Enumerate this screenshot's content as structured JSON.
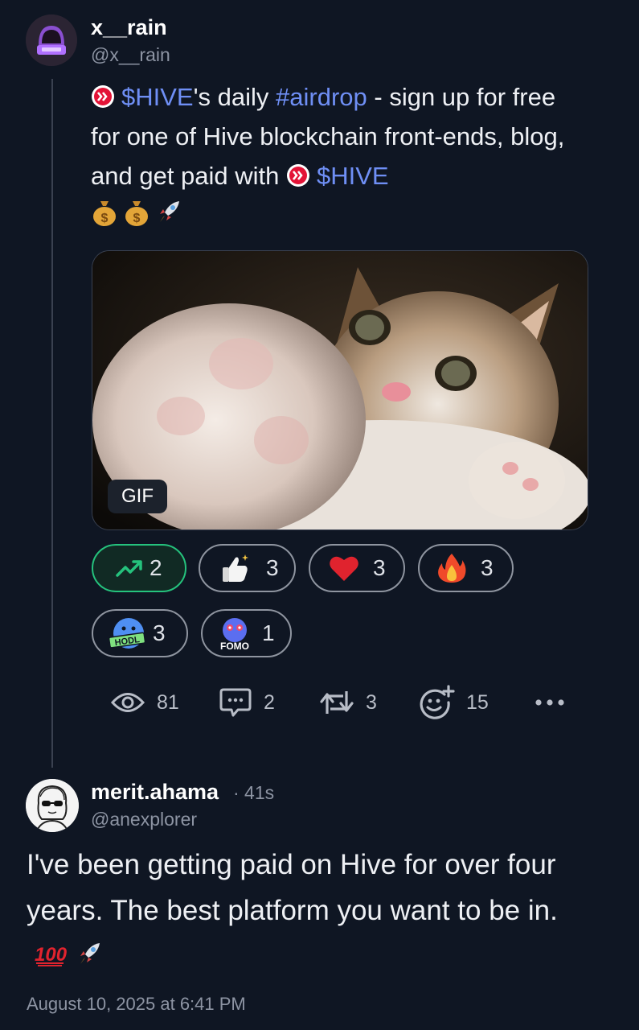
{
  "post": {
    "display_name": "x__rain",
    "handle": "@x__rain",
    "text": {
      "part1": "$HIVE",
      "part2": "'s daily ",
      "part3": "#airdrop",
      "part4": " - sign up for free for one of Hive blockchain front-ends, blog, and get paid with ",
      "part5": "$HIVE"
    },
    "emojis": [
      "money-bag",
      "money-bag",
      "rocket"
    ],
    "media": {
      "badge": "GIF"
    }
  },
  "reactions": [
    {
      "icon": "trending-up-icon",
      "count": "2",
      "active": true
    },
    {
      "icon": "thumbs-up-icon",
      "count": "3",
      "active": false
    },
    {
      "icon": "heart-icon",
      "count": "3",
      "active": false
    },
    {
      "icon": "fire-icon",
      "count": "3",
      "active": false
    },
    {
      "icon": "hodl-icon",
      "count": "3",
      "active": false
    },
    {
      "icon": "fomo-icon",
      "count": "1",
      "active": false
    }
  ],
  "stats": {
    "views": "81",
    "comments": "2",
    "reposts": "3",
    "reactions": "15"
  },
  "reply": {
    "display_name": "merit.ahama",
    "time_ago": "· 41s",
    "handle": "@anexplorer",
    "text": "I've been getting paid on Hive for over four years. The best platform you want to be in.",
    "emojis": [
      "hundred-points",
      "rocket"
    ],
    "timestamp": "August 10, 2025 at 6:41 PM"
  },
  "colors": {
    "background": "#0f1623",
    "link": "#6f8ff5",
    "active_green": "#25c27d",
    "muted": "#8d94a3"
  }
}
